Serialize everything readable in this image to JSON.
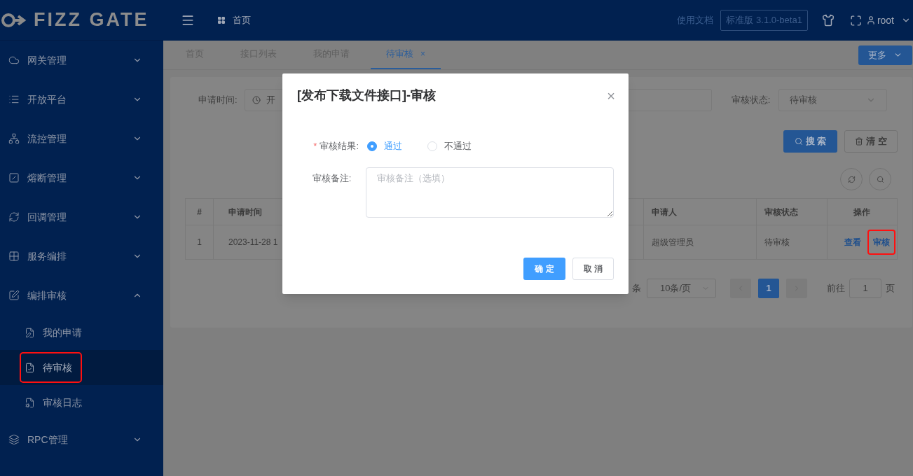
{
  "logo": {
    "text": "FIZZ GATE"
  },
  "header": {
    "breadcrumb": "首页",
    "docs_link": "使用文档",
    "version": "标准版 3.1.0-beta1",
    "user": "root"
  },
  "sidebar": {
    "items": [
      {
        "label": "网关管理",
        "expanded": false
      },
      {
        "label": "开放平台",
        "expanded": false
      },
      {
        "label": "流控管理",
        "expanded": false
      },
      {
        "label": "熔断管理",
        "expanded": false
      },
      {
        "label": "回调管理",
        "expanded": false
      },
      {
        "label": "服务编排",
        "expanded": false
      },
      {
        "label": "编排审核",
        "expanded": true,
        "children": [
          {
            "label": "我的申请",
            "selected": false,
            "highlighted": false
          },
          {
            "label": "待审核",
            "selected": true,
            "highlighted": true
          },
          {
            "label": "审核日志",
            "selected": false,
            "highlighted": false
          }
        ]
      },
      {
        "label": "RPC管理",
        "expanded": false
      }
    ]
  },
  "tabs": [
    {
      "label": "首页",
      "selected": false
    },
    {
      "label": "接口列表",
      "selected": false
    },
    {
      "label": "我的申请",
      "selected": false
    },
    {
      "label": "待审核",
      "selected": true,
      "close": "×"
    }
  ],
  "more_button": "更多",
  "filters": {
    "time_label": "申请时间:",
    "time_placeholder": "开",
    "status_label": "审核状态:",
    "status_value": "待审核"
  },
  "search_button": "搜 索",
  "clear_button": "清 空",
  "table": {
    "columns": [
      "#",
      "申请时间",
      "申请人",
      "审核状态",
      "操作"
    ],
    "rows": [
      {
        "index": "1",
        "time": "2023-11-28 1",
        "applicant": "超级管理员",
        "status": "待审核",
        "actions": [
          {
            "label": "查看",
            "highlighted": false
          },
          {
            "label": "审核",
            "highlighted": true
          }
        ]
      }
    ]
  },
  "pagination": {
    "total": "条",
    "page_size": "10条/页",
    "pages": [
      {
        "label": "1",
        "selected": true
      }
    ],
    "goto_label": "前往",
    "goto_value": "1",
    "page_suffix": "页"
  },
  "dialog": {
    "title": "[发布下载文件接口]-审核",
    "close": "×",
    "result_label": "审核结果:",
    "required": "*",
    "options": [
      {
        "label": "通过",
        "selected": true
      },
      {
        "label": "不通过",
        "selected": false
      }
    ],
    "remark_label": "审核备注:",
    "remark_placeholder": "审核备注（选填）",
    "confirm": "确 定",
    "cancel": "取 消"
  }
}
